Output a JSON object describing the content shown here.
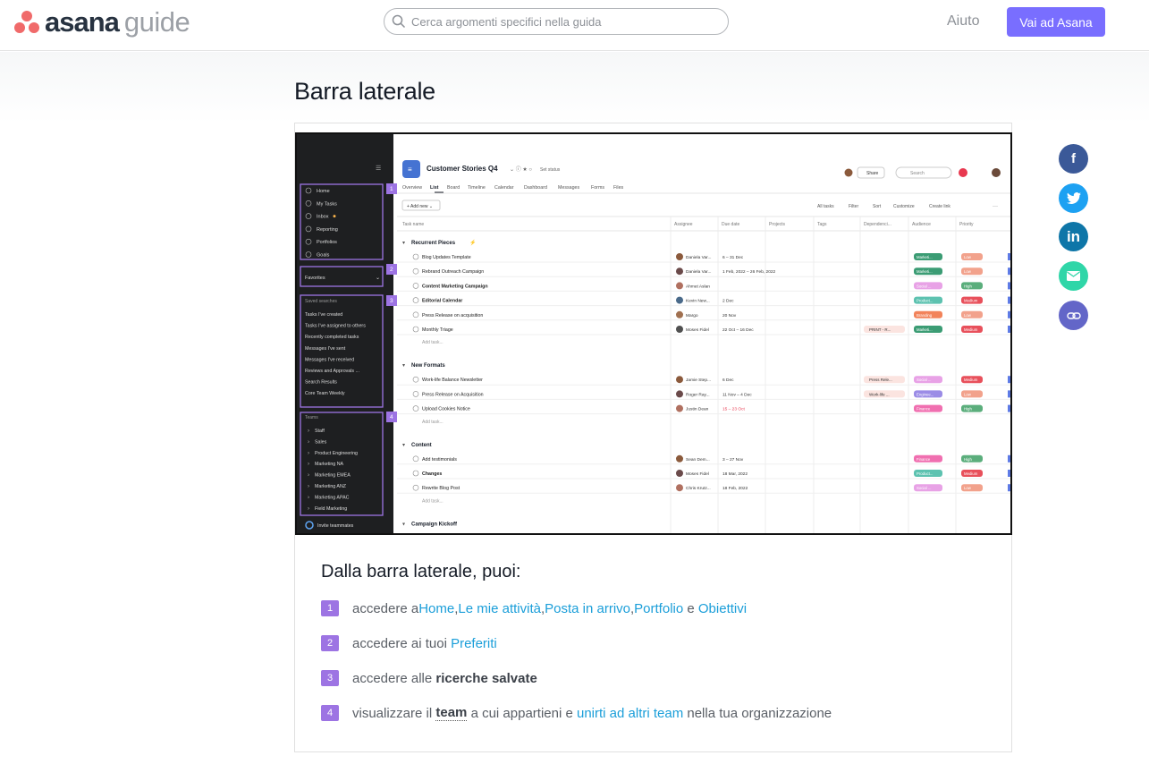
{
  "header": {
    "logo_word": "asana",
    "logo_guide": "guide",
    "search_placeholder": "Cerca argomenti specifici nella guida",
    "help_label": "Aiuto",
    "cta_label": "Vai ad Asana"
  },
  "page": {
    "title": "Barra laterale"
  },
  "screenshot": {
    "project_title": "Customer Stories Q4",
    "set_status": "Set status",
    "share": "Share",
    "search": "Search",
    "tabs": [
      "Overview",
      "List",
      "Board",
      "Timeline",
      "Calendar",
      "Dashboard",
      "Messages",
      "Forms",
      "Files"
    ],
    "add_new": "Add new",
    "toolbar": [
      "All tasks",
      "Filter",
      "Sort",
      "Customize",
      "Create link"
    ],
    "columns": [
      "Task name",
      "Assignee",
      "Due date",
      "Projects",
      "Tags",
      "Dependenci...",
      "Audience",
      "Priority"
    ],
    "sidebar": {
      "nav": [
        "Home",
        "My Tasks",
        "Inbox",
        "Reporting",
        "Portfolios",
        "Goals"
      ],
      "favorites": "Favorites",
      "saved_header": "Saved searches",
      "saved": [
        "Tasks I've created",
        "Tasks I've assigned to others",
        "Recently completed tasks",
        "Messages I've sent",
        "Messages I've received",
        "Reviews and Approvals ...",
        "Search Results",
        "Core Team Weekly"
      ],
      "teams_header": "Teams",
      "teams": [
        "Staff",
        "Sales",
        "Product Engineering",
        "Marketing NA",
        "Marketing EMEA",
        "Marketing ANZ",
        "Marketing APAC",
        "Field Marketing"
      ],
      "invite": "Invite teammates",
      "badges": [
        "1",
        "2",
        "3",
        "4"
      ]
    },
    "sections": [
      {
        "name": "Recurrent Pieces",
        "tasks": [
          {
            "name": "Blog Updates Template",
            "assignee": "Daniela Var...",
            "due": "6 – 31 Dec",
            "dep": "",
            "aud": "Marketi...",
            "pri": "Low"
          },
          {
            "name": "Rebrand Outreach Campaign",
            "assignee": "Daniela Var...",
            "due": "1 Feb, 2022 – 26 Feb, 2022",
            "dep": "",
            "aud": "Marketi...",
            "pri": "Low"
          },
          {
            "name": "Content Marketing Campaign",
            "assignee": "Ahmet Aslan",
            "due": "",
            "dep": "",
            "aud": "Social ...",
            "pri": "High"
          },
          {
            "name": "Editorial Calendar",
            "assignee": "Kevin New...",
            "due": "2 Dec",
            "dep": "",
            "aud": "Product...",
            "pri": "Medium"
          },
          {
            "name": "Press Release on acquisition",
            "assignee": "Margo",
            "due": "20 Nov",
            "dep": "",
            "aud": "Branding",
            "pri": "Low"
          },
          {
            "name": "Monthly Triage",
            "assignee": "Moses Fidel",
            "due": "22 Oct – 16 Dec",
            "dep": "PRINT - R...",
            "aud": "Marketi...",
            "pri": "Medium"
          }
        ]
      },
      {
        "name": "New Formats",
        "tasks": [
          {
            "name": "Work-life Balance Newsletter",
            "assignee": "Jamie Step...",
            "due": "6 Dec",
            "dep": "Press Rele...",
            "aud": "Social ...",
            "pri": "Medium"
          },
          {
            "name": "Press Release on Acquisition",
            "assignee": "Roger Ray...",
            "due": "11 Nov – 4 Dec",
            "dep": "Work-life ...",
            "aud": "Enginee...",
            "pri": "Low"
          },
          {
            "name": "Upload Cookies Notice",
            "assignee": "Justin Dean",
            "due": "15 – 23 Oct",
            "dep": "",
            "aud": "Finance",
            "pri": "High"
          }
        ]
      },
      {
        "name": "Content",
        "tasks": [
          {
            "name": "Add testimonials",
            "assignee": "Sean Dem...",
            "due": "3 – 27 Nov",
            "dep": "",
            "aud": "Finance",
            "pri": "High"
          },
          {
            "name": "Changes",
            "assignee": "Moses Fidel",
            "due": "18 Mar, 2022",
            "dep": "",
            "aud": "Product...",
            "pri": "Medium"
          },
          {
            "name": "Rewrite Blog Post",
            "assignee": "Chris Krutz...",
            "due": "18 Feb, 2022",
            "dep": "",
            "aud": "Social ...",
            "pri": "Low"
          }
        ]
      },
      {
        "name": "Campaign Kickoff",
        "tasks": []
      }
    ],
    "add_task": "Add task..."
  },
  "content": {
    "subtitle": "Dalla barra laterale, puoi:",
    "items": [
      {
        "num": "1",
        "p1": "accedere a ",
        "l1": "Home",
        "s1": ", ",
        "l2": "Le mie attività",
        "s2": ", ",
        "l3": "Posta in arrivo",
        "s3": ", ",
        "l4": "Portfolio",
        "s4": " e ",
        "l5": "Obiettivi"
      },
      {
        "num": "2",
        "p1": "accedere ai tuoi ",
        "l1": "Preferiti"
      },
      {
        "num": "3",
        "p1": "accedere alle ",
        "b1": "ricerche salvate"
      },
      {
        "num": "4",
        "p1": "visualizzare il ",
        "b1": "team",
        "p2": " a cui appartieni e ",
        "l1": "unirti ad altri team",
        "p3": " nella tua organizzazione"
      }
    ]
  },
  "share_icons": [
    "facebook-icon",
    "twitter-icon",
    "linkedin-icon",
    "email-icon",
    "link-icon"
  ],
  "colors": {
    "brand_purple": "#796eff",
    "badge_purple": "#9d74e3",
    "link_blue": "#1a9ed9",
    "asana_coral": "#f06a6a"
  }
}
